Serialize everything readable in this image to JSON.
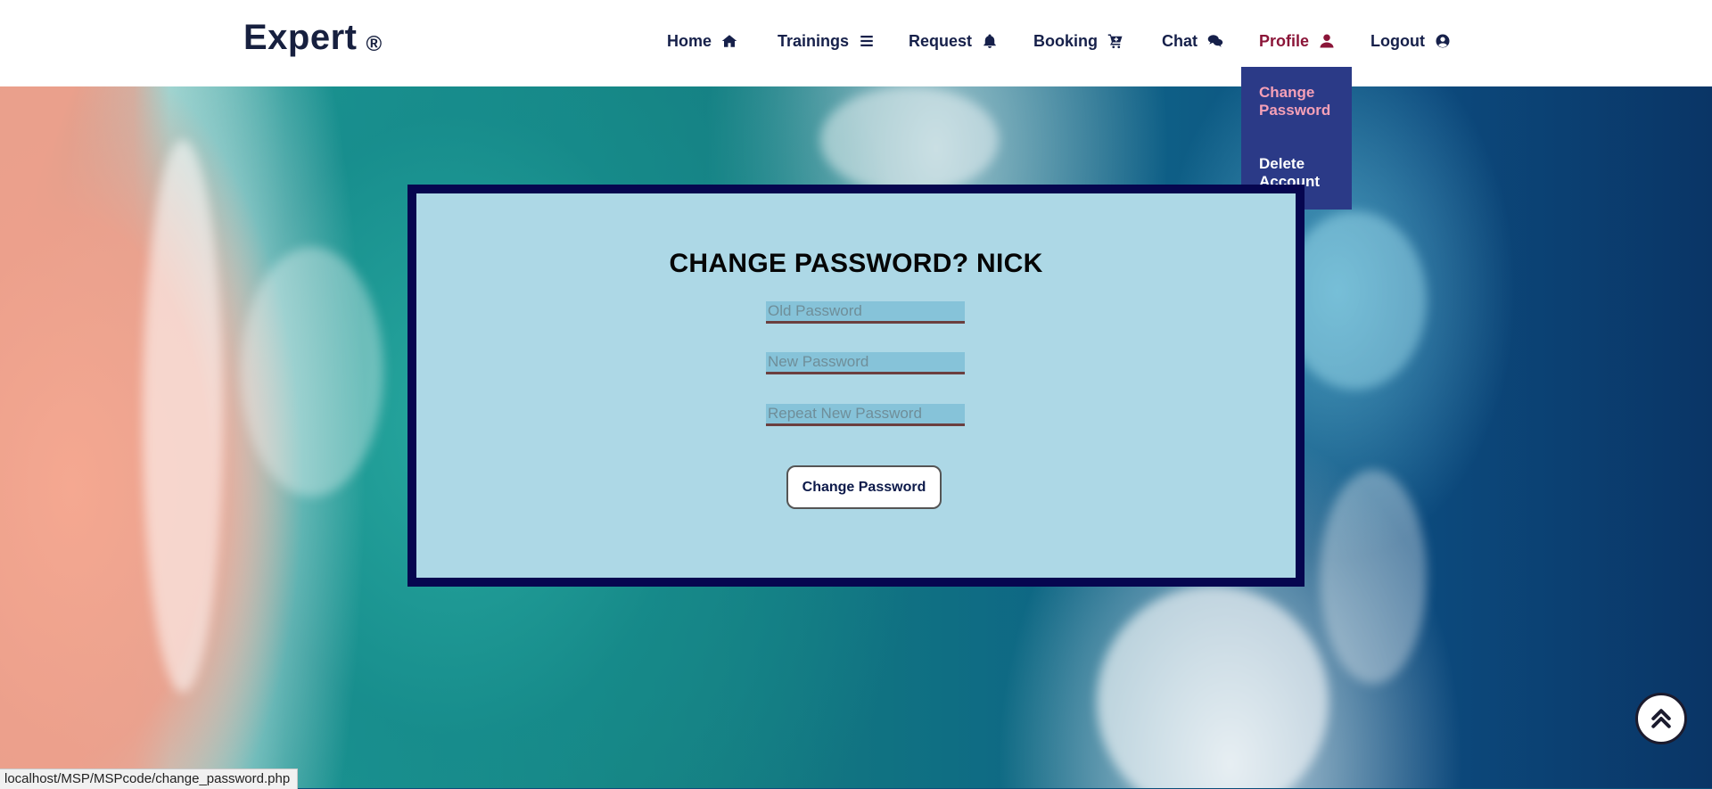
{
  "brand": {
    "name": "Expert",
    "reg_mark": "®"
  },
  "nav": [
    {
      "label": "Home",
      "icon": "home-icon"
    },
    {
      "label": "Trainings",
      "icon": "bars-icon"
    },
    {
      "label": "Request",
      "icon": "bell-icon"
    },
    {
      "label": "Booking",
      "icon": "cart-icon"
    },
    {
      "label": "Chat",
      "icon": "comments-icon"
    },
    {
      "label": "Profile",
      "icon": "user-icon",
      "active": true
    },
    {
      "label": "Logout",
      "icon": "user-circle-icon"
    }
  ],
  "profile_menu": {
    "items": [
      {
        "label": "Change Password"
      },
      {
        "label": "Delete Account"
      }
    ]
  },
  "form": {
    "title": "CHANGE PASSWORD? NICK",
    "old_password": {
      "placeholder": "Old Password",
      "value": ""
    },
    "new_password": {
      "placeholder": "New Password",
      "value": ""
    },
    "repeat_password": {
      "placeholder": "Repeat New Password",
      "value": ""
    },
    "submit_label": "Change Password"
  },
  "scroll_top": {
    "icon": "double-chevron-up-icon"
  },
  "status_bar": {
    "url": "localhost/MSP/MSPcode/change_password.php"
  },
  "colors": {
    "nav_text": "#16204a",
    "nav_active": "#8b1538",
    "dropdown_bg": "#2b3a87",
    "dropdown_active": "#f5a0b7",
    "card_bg": "#add8e6",
    "card_border": "#06064f"
  }
}
